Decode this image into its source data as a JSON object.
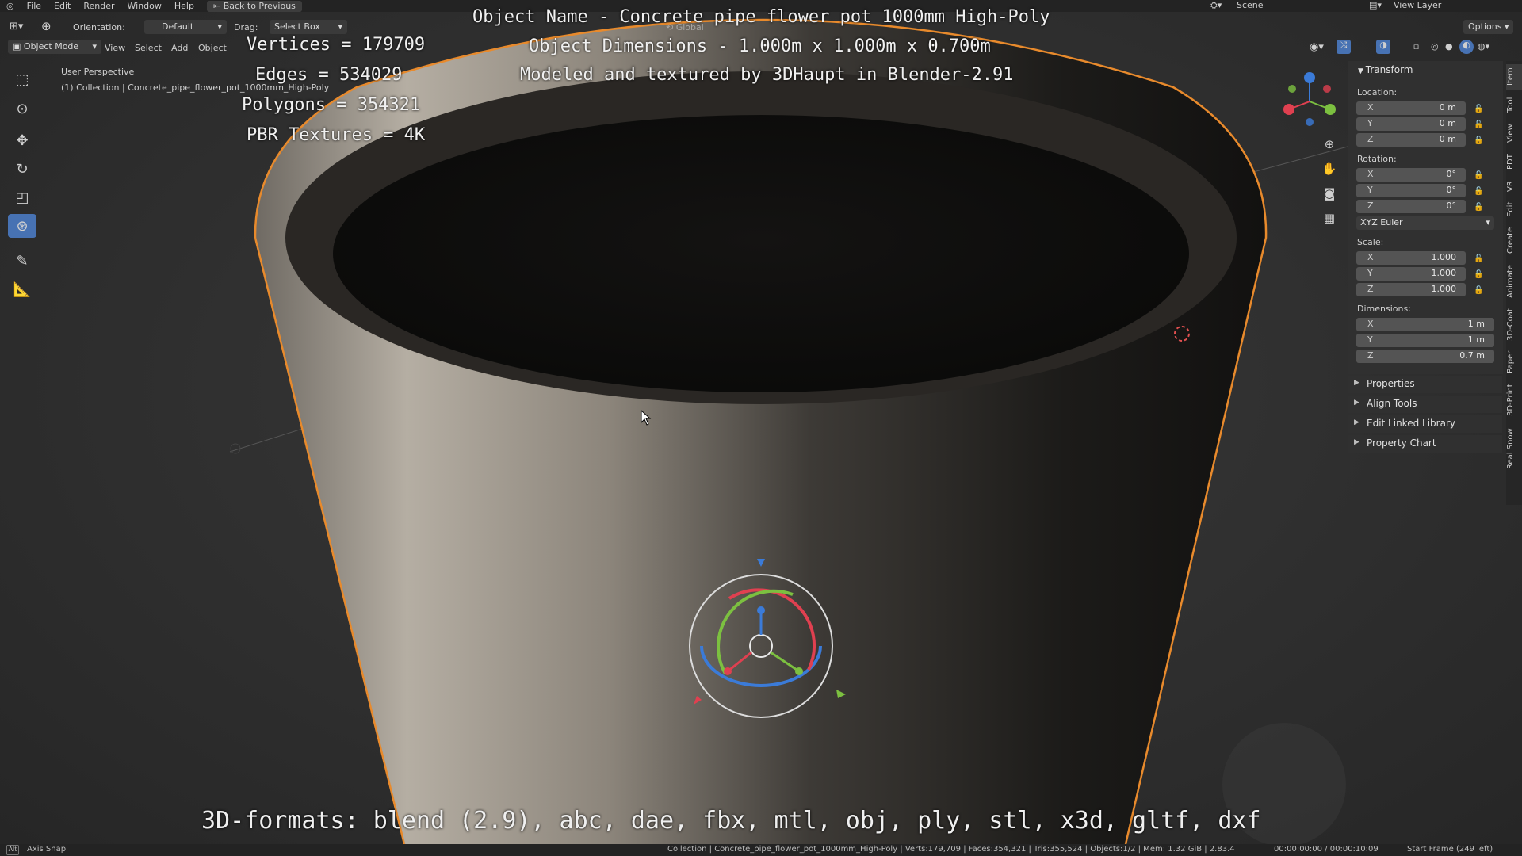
{
  "menu": {
    "items": [
      "File",
      "Edit",
      "Render",
      "Window",
      "Help"
    ],
    "back_button": "Back to Previous",
    "scene_label": "Scene",
    "view_layer_label": "View Layer"
  },
  "header": {
    "orientation_label": "Orientation:",
    "orientation_value": "Default",
    "drag_label": "Drag:",
    "drag_value": "Select Box",
    "transform_space": "Global",
    "options_label": "Options"
  },
  "subheader": {
    "mode": "Object Mode",
    "view": "View",
    "select": "Select",
    "add": "Add",
    "object": "Object"
  },
  "viewport": {
    "perspective": "User Perspective",
    "collection_line": "(1) Collection | Concrete_pipe_flower_pot_1000mm_High-Poly"
  },
  "overlay": {
    "vertices": "Vertices = 179709",
    "edges": "Edges = 534029",
    "polygons": "Polygons = 354321",
    "textures": "PBR Textures = 4K",
    "object_name": "Object Name - Concrete pipe flower pot 1000mm High-Poly",
    "object_dimensions": "Object Dimensions -  1.000m x 1.000m x 0.700m",
    "modeled_by": "Modeled and textured by 3DHaupt in Blender-2.91",
    "formats": "3D-formats: blend (2.9), abc, dae, fbx, mtl, obj, ply, stl, x3d, gltf, dxf"
  },
  "npanel": {
    "title": "Transform",
    "location_label": "Location:",
    "location": [
      {
        "axis": "X",
        "value": "0 m"
      },
      {
        "axis": "Y",
        "value": "0 m"
      },
      {
        "axis": "Z",
        "value": "0 m"
      }
    ],
    "rotation_label": "Rotation:",
    "rotation": [
      {
        "axis": "X",
        "value": "0°"
      },
      {
        "axis": "Y",
        "value": "0°"
      },
      {
        "axis": "Z",
        "value": "0°"
      }
    ],
    "rotation_mode": "XYZ Euler",
    "scale_label": "Scale:",
    "scale": [
      {
        "axis": "X",
        "value": "1.000"
      },
      {
        "axis": "Y",
        "value": "1.000"
      },
      {
        "axis": "Z",
        "value": "1.000"
      }
    ],
    "dimensions_label": "Dimensions:",
    "dimensions": [
      {
        "axis": "X",
        "value": "1 m"
      },
      {
        "axis": "Y",
        "value": "1 m"
      },
      {
        "axis": "Z",
        "value": "0.7 m"
      }
    ],
    "sections": [
      "Properties",
      "Align Tools",
      "Edit Linked Library",
      "Property Chart"
    ]
  },
  "vtabs": [
    "Item",
    "Tool",
    "View",
    "PDT",
    "VR",
    "Edit",
    "Create",
    "Animate",
    "3D-Coat",
    "Paper",
    "3D-Print",
    "Real Snow"
  ],
  "status": {
    "left": "Axis Snap",
    "stats": "Collection | Concrete_pipe_flower_pot_1000mm_High-Poly | Verts:179,709 | Faces:354,321 | Tris:355,524 | Objects:1/2 | Mem: 1.32 GiB | 2.83.4",
    "time": "00:00:00:00 / 00:00:10:09",
    "frame": "Start Frame (249 left)"
  },
  "colors": {
    "accent": "#4772b3",
    "selection_outline": "#e88a2c",
    "panel": "#303030"
  }
}
